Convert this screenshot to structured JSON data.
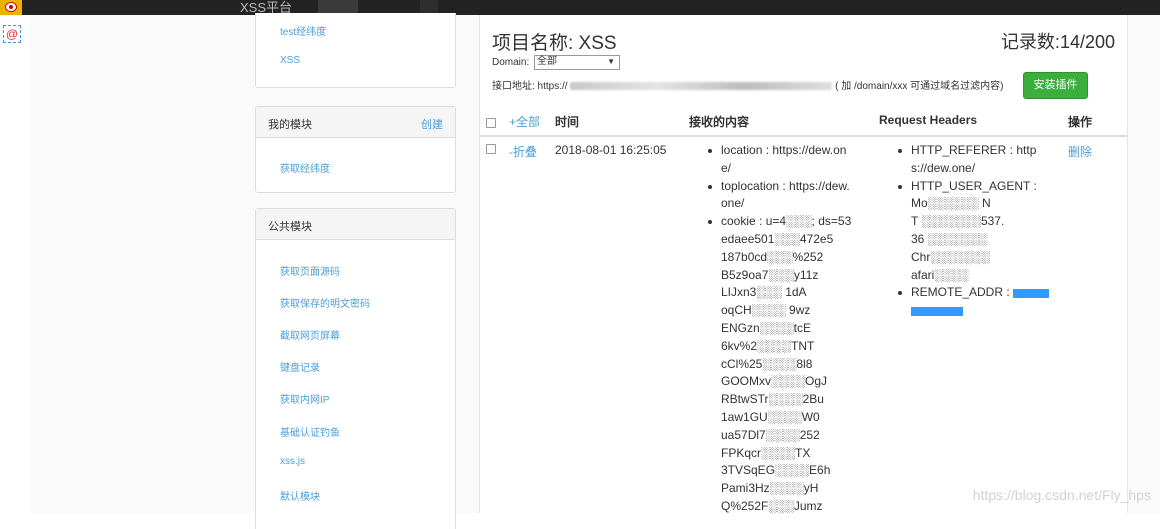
{
  "topbar": {
    "app_title": "XSS平台"
  },
  "sidebar": {
    "top_links": [
      "test经纬度",
      "XSS"
    ],
    "my_modules": {
      "title": "我的模块",
      "action": "创建",
      "items": [
        "获取经纬度"
      ]
    },
    "public_modules": {
      "title": "公共模块",
      "items": [
        "获取页面源码",
        "获取保存的明文密码",
        "截取网页屏幕",
        "键盘记录",
        "获取内网IP",
        "基础认证钓鱼",
        "xss.js",
        "默认模块"
      ]
    }
  },
  "main": {
    "project_label": "项目名称: XSS",
    "record_count": "记录数:14/200",
    "domain_label": "Domain:",
    "domain_selected": "全部",
    "api_label": "接口地址: https://",
    "api_hint": "( 加 /domain/xxx 可通过域名过滤内容)",
    "install_button": "安装插件",
    "table": {
      "headers": {
        "expand_all": "+全部",
        "time": "时间",
        "content": "接收的内容",
        "headers": "Request Headers",
        "actions": "操作"
      },
      "rows": [
        {
          "toggle": "-折叠",
          "time": "2018-08-01 16:25:05",
          "content_lines": [
            [
              "location : https://dew.on",
              "e/"
            ],
            [
              "toplocation : https://dew.",
              "one/"
            ],
            [
              "cookie : u=4░░░; ds=53",
              "edaee501░░░472e5",
              "187b0cd░░░%252",
              "B5z9oa7░░░y11z",
              "LIJxn3░░░ 1dA",
              "oqCH░░░░ 9wz",
              "ENGzn░░░░tcE",
              "6kv%2░░░░TNT",
              "cCl%25░░░░8l8",
              "GOOMxv░░░░OgJ",
              "RBtwSTr░░░░2Bu",
              "1aw1GU░░░░W0",
              "ua57Dl7░░░░252",
              "FPKqcr░░░░TX",
              "3TVSqEG░░░░E6h",
              "Pami3Hz░░░░yH",
              "Q%252F░░░Jumz"
            ]
          ],
          "header_lines": [
            [
              "HTTP_REFERER : http",
              "s://dew.one/"
            ],
            [
              "HTTP_USER_AGENT :",
              "Mo░░░░░░ N",
              "T ░░░░░░░537.",
              "36 ░░░░░░░",
              "Chr░░░░░░░",
              "afari░░░░"
            ],
            [
              "REMOTE_ADDR :"
            ]
          ],
          "action": "删除"
        }
      ]
    }
  },
  "watermark": "https://blog.csdn.net/Fly_hps"
}
